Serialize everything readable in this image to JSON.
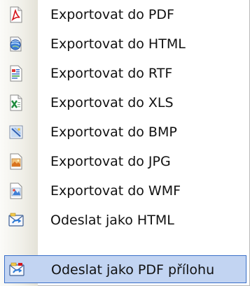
{
  "menu": {
    "items": [
      {
        "label": "Exportovat do PDF",
        "icon": "pdf-file-icon"
      },
      {
        "label": "Exportovat do HTML",
        "icon": "html-globe-icon"
      },
      {
        "label": "Exportovat do RTF",
        "icon": "rtf-document-icon"
      },
      {
        "label": "Exportovat do XLS",
        "icon": "excel-spreadsheet-icon"
      },
      {
        "label": "Exportovat do BMP",
        "icon": "bitmap-image-icon"
      },
      {
        "label": "Exportovat do JPG",
        "icon": "jpg-image-icon"
      },
      {
        "label": "Exportovat do WMF",
        "icon": "wmf-image-icon"
      },
      {
        "label": "Odeslat jako HTML",
        "icon": "send-email-html-icon"
      },
      {
        "label": "Odeslat jako PDF přílohu",
        "icon": "send-email-pdf-icon",
        "highlighted": true
      }
    ]
  },
  "colors": {
    "highlight_fill": "#c2d4f2",
    "highlight_border": "#3a6fc8",
    "text": "#111111"
  }
}
